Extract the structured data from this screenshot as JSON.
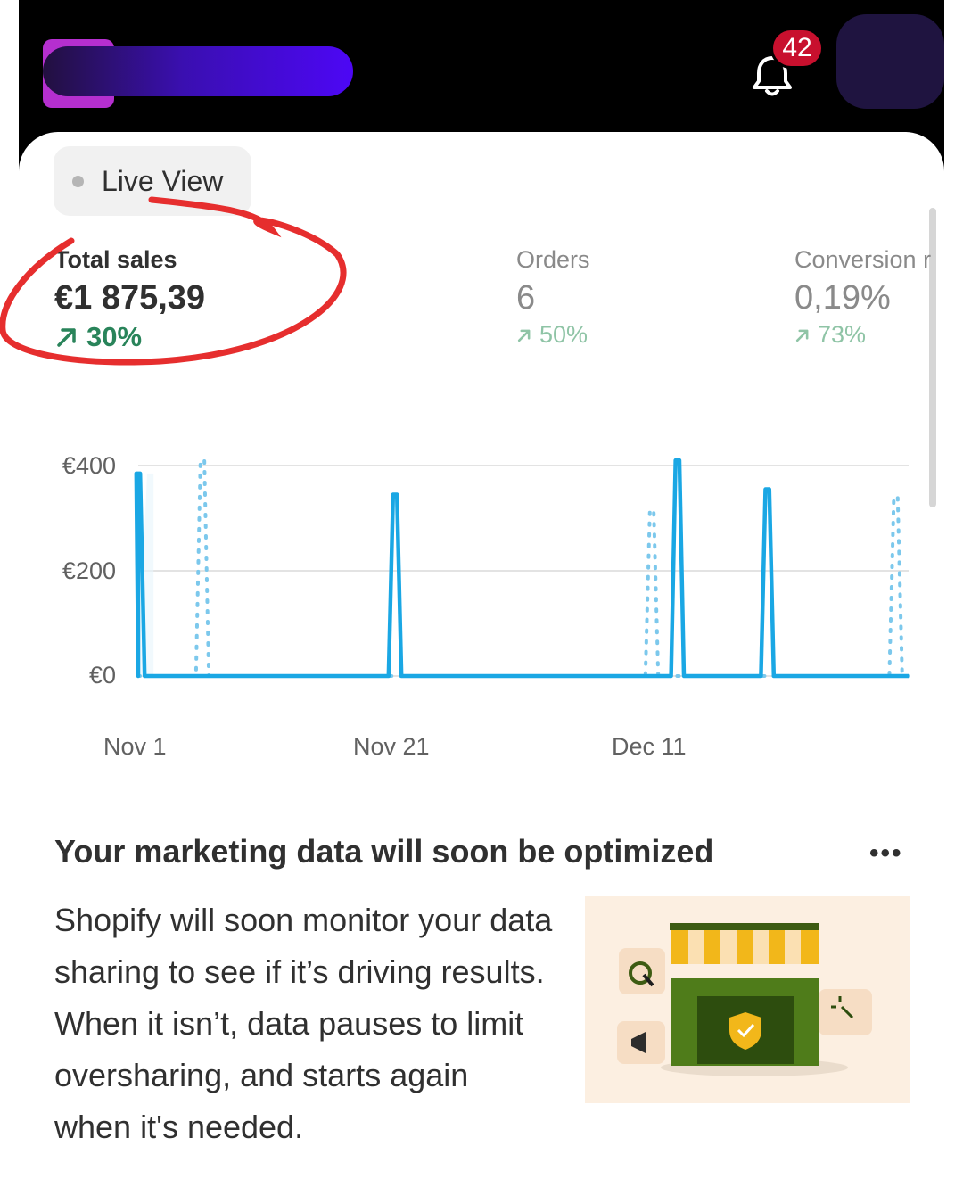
{
  "header": {
    "notification_count": "42",
    "colors": {
      "logo": "#b52fcf",
      "bar_start": "#22103f",
      "bar_end": "#4d07f5",
      "avatar": "#1f1440",
      "badge": "#c8102e"
    },
    "icons": [
      "store-logo",
      "bell-icon",
      "avatar"
    ]
  },
  "live_view": {
    "label": "Live View"
  },
  "metrics": [
    {
      "label": "Total sales",
      "value": "€1 875,39",
      "change": "30%"
    },
    {
      "label": "Orders",
      "value": "6",
      "change": "50%"
    },
    {
      "label": "Conversion r",
      "value": "0,19%",
      "change": "73%"
    }
  ],
  "chart_data": {
    "type": "line",
    "x": [
      "Nov 1",
      "Nov 2",
      "Nov 3",
      "Nov 4",
      "Nov 5",
      "Nov 6",
      "Nov 7",
      "Nov 8",
      "Nov 9",
      "Nov 10",
      "Nov 11",
      "Nov 12",
      "Nov 13",
      "Nov 14",
      "Nov 15",
      "Nov 16",
      "Nov 17",
      "Nov 18",
      "Nov 19",
      "Nov 20",
      "Nov 21",
      "Nov 22",
      "Nov 23",
      "Nov 24",
      "Nov 25",
      "Nov 26",
      "Nov 27",
      "Nov 28",
      "Nov 29",
      "Nov 30",
      "Dec 1",
      "Dec 2",
      "Dec 3",
      "Dec 4",
      "Dec 5",
      "Dec 6",
      "Dec 7",
      "Dec 8",
      "Dec 9",
      "Dec 10",
      "Dec 11",
      "Dec 12",
      "Dec 13",
      "Dec 14",
      "Dec 15",
      "Dec 16",
      "Dec 17",
      "Dec 18",
      "Dec 19",
      "Dec 20",
      "Dec 21",
      "Dec 22",
      "Dec 23",
      "Dec 24",
      "Dec 25",
      "Dec 26",
      "Dec 27",
      "Dec 28",
      "Dec 29",
      "Dec 30",
      "Dec 31"
    ],
    "series": [
      {
        "style": "solid",
        "color": "#1aa7e4",
        "values": [
          385,
          0,
          0,
          0,
          0,
          0,
          0,
          0,
          0,
          0,
          0,
          0,
          0,
          0,
          0,
          0,
          0,
          0,
          0,
          0,
          345,
          0,
          0,
          0,
          0,
          0,
          0,
          0,
          0,
          0,
          0,
          0,
          0,
          0,
          0,
          0,
          0,
          0,
          0,
          0,
          0,
          0,
          410,
          0,
          0,
          0,
          0,
          0,
          0,
          355,
          0,
          0,
          0,
          0,
          0,
          0,
          0,
          0,
          0,
          0,
          0
        ]
      },
      {
        "style": "dotted",
        "color": "#7cc8ec",
        "values": [
          0,
          0,
          0,
          0,
          0,
          410,
          0,
          0,
          0,
          0,
          0,
          0,
          0,
          0,
          0,
          0,
          0,
          0,
          0,
          0,
          0,
          0,
          0,
          0,
          0,
          0,
          0,
          0,
          0,
          0,
          0,
          0,
          0,
          0,
          0,
          0,
          0,
          0,
          0,
          0,
          315,
          0,
          0,
          0,
          0,
          0,
          0,
          0,
          0,
          0,
          0,
          0,
          0,
          0,
          0,
          0,
          0,
          0,
          0,
          340,
          0
        ]
      }
    ],
    "yticks": [
      "€400",
      "€200",
      "€0"
    ],
    "ytick_values": [
      400,
      200,
      0
    ],
    "xticks": [
      "Nov 1",
      "Nov 21",
      "Dec 11"
    ],
    "ylim": [
      0,
      400
    ],
    "grid": true
  },
  "marketing": {
    "title": "Your marketing data will soon be optimized",
    "more": "•••",
    "body": "Shopify will soon monitor your data sharing to see if it’s driving results. When it isn’t, data pauses to limit oversharing, and starts again when it's needed."
  }
}
